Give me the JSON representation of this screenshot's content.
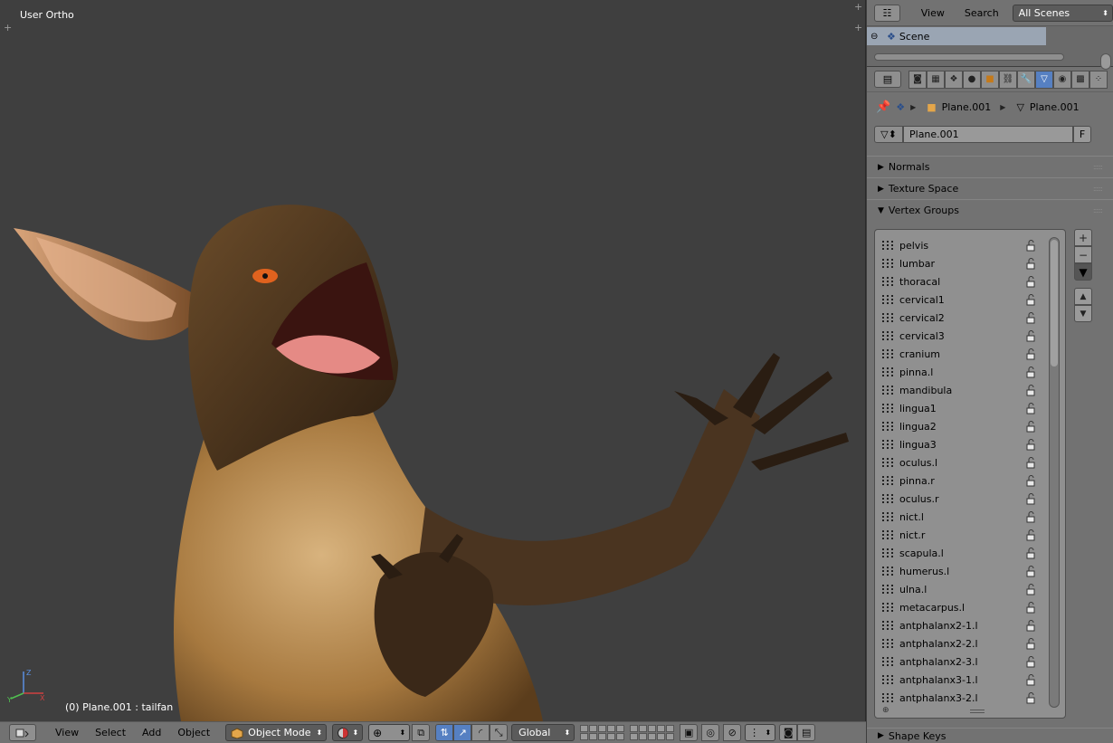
{
  "viewport": {
    "title": "User Ortho",
    "status": "(0) Plane.001 : tailfan"
  },
  "header": {
    "menus": [
      "View",
      "Select",
      "Add",
      "Object"
    ],
    "mode": "Object Mode",
    "orientation": "Global"
  },
  "outliner": {
    "view_label": "View",
    "search_label": "Search",
    "scenes_dropdown": "All Scenes",
    "scene_name": "Scene"
  },
  "properties": {
    "breadcrumb_object": "Plane.001",
    "breadcrumb_mesh": "Plane.001",
    "mesh_name": "Plane.001",
    "fake_user_label": "F",
    "panels": {
      "normals": "Normals",
      "texture_space": "Texture Space",
      "vertex_groups": "Vertex Groups",
      "shape_keys": "Shape Keys"
    },
    "vertex_groups": [
      "pelvis",
      "lumbar",
      "thoracal",
      "cervical1",
      "cervical2",
      "cervical3",
      "cranium",
      "pinna.l",
      "mandibula",
      "lingua1",
      "lingua2",
      "lingua3",
      "oculus.l",
      "pinna.r",
      "oculus.r",
      "nict.l",
      "nict.r",
      "scapula.l",
      "humerus.l",
      "ulna.l",
      "metacarpus.l",
      "antphalanx2-1.l",
      "antphalanx2-2.l",
      "antphalanx2-3.l",
      "antphalanx3-1.l",
      "antphalanx3-2.l"
    ]
  },
  "colors": {
    "viewport_bg": "#3f3f3f",
    "panel_bg": "#727272",
    "active_tab": "#5680c2"
  }
}
